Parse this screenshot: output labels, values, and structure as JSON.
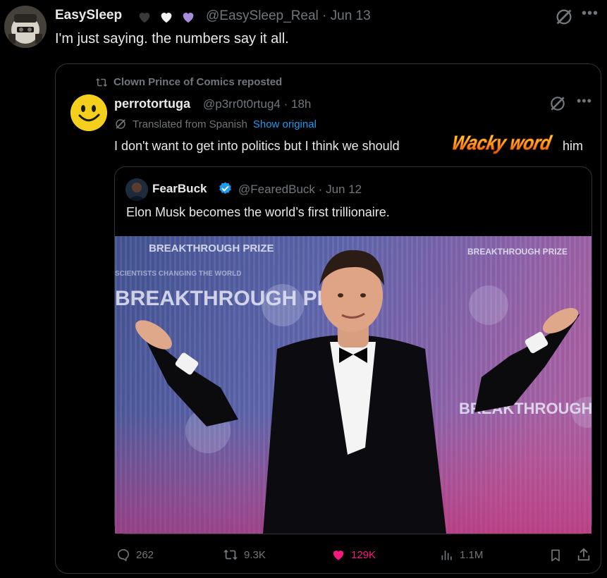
{
  "top_post": {
    "display_name": "EasySleep",
    "handle": "@EasySleep_Real",
    "date": "Jun 13",
    "text": "I'm just saying. the numbers say it all.",
    "badges": [
      "black-heart-icon",
      "white-heart-icon",
      "purple-heart-icon"
    ]
  },
  "repost": {
    "label": "Clown Prince of Comics reposted",
    "author": {
      "display_name": "perrotortuga",
      "handle": "@p3rr0t0rtug4",
      "age": "18h"
    },
    "translated_label": "Translated from Spanish",
    "show_original_label": "Show original",
    "text_before": "I don't want to get into politics but I think we should",
    "sticker_text": "Wacky word",
    "text_after": "him",
    "quoted": {
      "display_name": "FearBuck",
      "handle": "@FearedBuck",
      "date": "Jun 12",
      "text": "Elon Musk becomes the world’s first trillionaire.",
      "backdrop_text": [
        "BREAKTHROUGH PRIZE",
        "SCIENTISTS CHANGING THE WORLD",
        "BREAKTHROUGH PRIZE",
        "BREAKTHROUGH PRIZE",
        "BREAKTHROUGH PRIZE"
      ]
    },
    "stats": {
      "replies": "262",
      "reposts": "9.3K",
      "likes": "129K",
      "views": "1.1M"
    }
  },
  "separator": "·",
  "colors": {
    "background": "#000000",
    "text": "#e7e9ea",
    "muted": "#71767b",
    "link": "#1d9bf0",
    "like": "#f91880",
    "border": "#2f3336",
    "verified": "#1d9bf0"
  }
}
